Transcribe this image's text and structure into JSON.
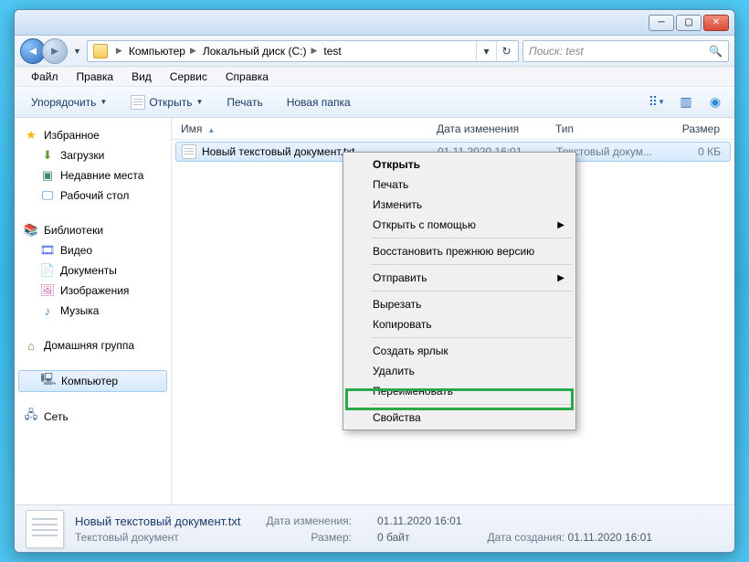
{
  "titlebar": {
    "min": "─",
    "max": "▢",
    "close": "✕"
  },
  "breadcrumbs": [
    "Компьютер",
    "Локальный диск (C:)",
    "test"
  ],
  "search": {
    "placeholder": "Поиск: test"
  },
  "menus": [
    "Файл",
    "Правка",
    "Вид",
    "Сервис",
    "Справка"
  ],
  "toolbar": {
    "organize": "Упорядочить",
    "open": "Открыть",
    "print": "Печать",
    "newfolder": "Новая папка"
  },
  "columns": {
    "name": "Имя",
    "date": "Дата изменения",
    "type": "Тип",
    "size": "Размер"
  },
  "sidebar": {
    "favorites": {
      "label": "Избранное",
      "items": [
        {
          "icon": "down",
          "label": "Загрузки"
        },
        {
          "icon": "recent",
          "label": "Недавние места"
        },
        {
          "icon": "desk",
          "label": "Рабочий стол"
        }
      ]
    },
    "libraries": {
      "label": "Библиотеки",
      "items": [
        {
          "icon": "vid",
          "label": "Видео"
        },
        {
          "icon": "doc",
          "label": "Документы"
        },
        {
          "icon": "img",
          "label": "Изображения"
        },
        {
          "icon": "mus",
          "label": "Музыка"
        }
      ]
    },
    "homegroup": {
      "label": "Домашняя группа"
    },
    "computer": {
      "label": "Компьютер"
    },
    "network": {
      "label": "Сеть"
    }
  },
  "file": {
    "name": "Новый текстовый документ.txt",
    "date": "01.11.2020 16:01",
    "type": "Текстовый докум...",
    "size": "0 КБ"
  },
  "context_menu": {
    "open": "Открыть",
    "print": "Печать",
    "edit": "Изменить",
    "openwith": "Открыть с помощью",
    "restore": "Восстановить прежнюю версию",
    "sendto": "Отправить",
    "cut": "Вырезать",
    "copy": "Копировать",
    "shortcut": "Создать ярлык",
    "delete": "Удалить",
    "rename": "Переименовать",
    "properties": "Свойства"
  },
  "status": {
    "filename": "Новый текстовый документ.txt",
    "filetype": "Текстовый документ",
    "modified_label": "Дата изменения:",
    "modified_value": "01.11.2020 16:01",
    "size_label": "Размер:",
    "size_value": "0 байт",
    "created_label": "Дата создания:",
    "created_value": "01.11.2020 16:01"
  }
}
